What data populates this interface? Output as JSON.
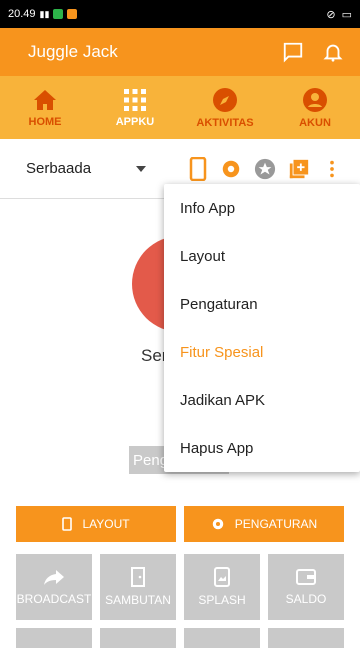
{
  "status_bar": {
    "time": "20.49"
  },
  "app_bar": {
    "title": "Juggle Jack"
  },
  "nav": {
    "items": [
      {
        "label": "HOME",
        "icon": "home-icon"
      },
      {
        "label": "APPKU",
        "icon": "grid-icon"
      },
      {
        "label": "AKTIVITAS",
        "icon": "compass-icon"
      },
      {
        "label": "AKUN",
        "icon": "account-icon"
      }
    ]
  },
  "toolbar": {
    "dropdown_value": "Serbaada"
  },
  "main": {
    "app_name": "Ser",
    "pill_text": "Peng",
    "layout_button": "LAYOUT",
    "settings_button": "PENGATURAN",
    "tiles": [
      {
        "label": "BROADCAST",
        "icon": "share-icon"
      },
      {
        "label": "SAMBUTAN",
        "icon": "door-icon"
      },
      {
        "label": "SPLASH",
        "icon": "image-icon"
      },
      {
        "label": "SALDO",
        "icon": "wallet-icon"
      }
    ]
  },
  "menu": {
    "items": [
      {
        "label": "Info App"
      },
      {
        "label": "Layout"
      },
      {
        "label": "Pengaturan"
      },
      {
        "label": "Fitur Spesial"
      },
      {
        "label": "Jadikan APK"
      },
      {
        "label": "Hapus App"
      }
    ]
  },
  "colors": {
    "accent": "#f7941d",
    "nav_bg": "#f8b33a",
    "nav_label": "#d94f00",
    "tile_bg": "#c9c9c9"
  }
}
